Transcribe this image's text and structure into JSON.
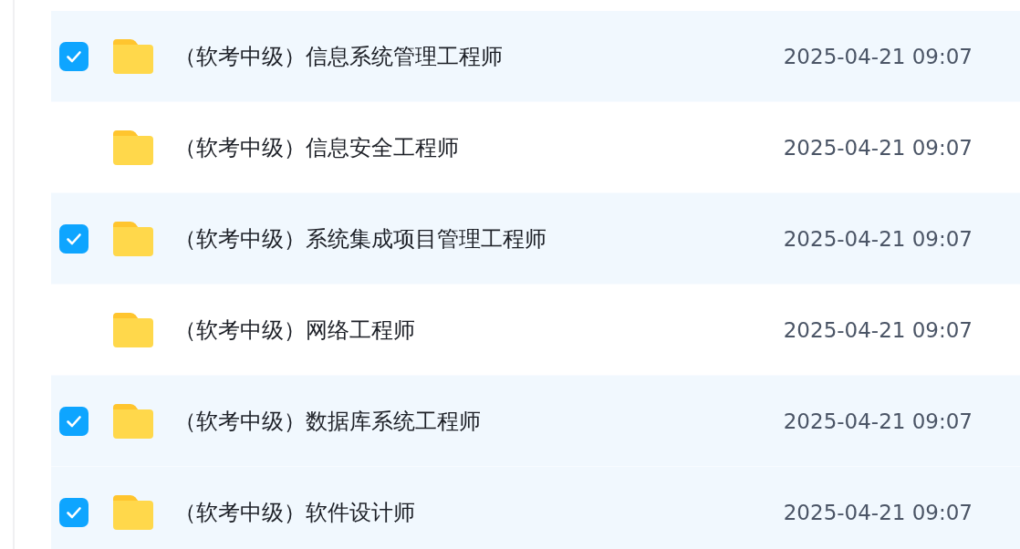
{
  "rows": [
    {
      "name": "（软考中级）信息系统管理工程师",
      "modified": "2025-04-21 09:07",
      "checked": true
    },
    {
      "name": "（软考中级）信息安全工程师",
      "modified": "2025-04-21 09:07",
      "checked": false
    },
    {
      "name": "（软考中级）系统集成项目管理工程师",
      "modified": "2025-04-21 09:07",
      "checked": true
    },
    {
      "name": "（软考中级）网络工程师",
      "modified": "2025-04-21 09:07",
      "checked": false
    },
    {
      "name": "（软考中级）数据库系统工程师",
      "modified": "2025-04-21 09:07",
      "checked": true
    },
    {
      "name": "（软考中级）软件设计师",
      "modified": "2025-04-21 09:07",
      "checked": true
    }
  ]
}
